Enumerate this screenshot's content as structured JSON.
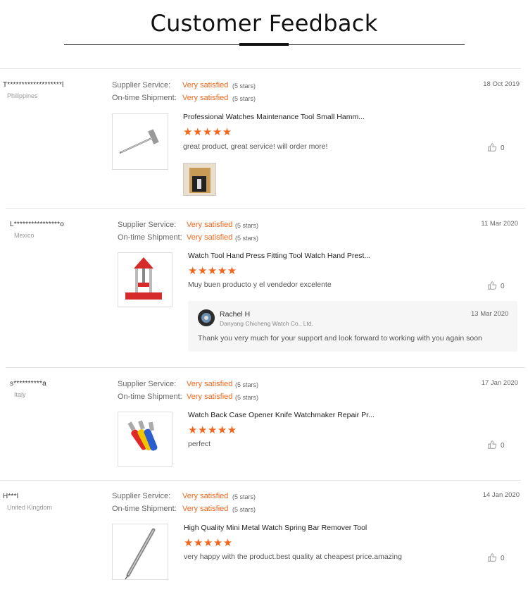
{
  "header": {
    "title": "Customer Feedback"
  },
  "labels": {
    "supplier_service": "Supplier Service:",
    "on_time_shipment": "On-time Shipment:"
  },
  "reviews": [
    {
      "buyer": "T*******************l",
      "country": "Philippines",
      "supplier_rating": "Very satisfied",
      "supplier_stars": "(5 stars)",
      "shipment_rating": "Very satisfied",
      "shipment_stars": "(5 stars)",
      "date": "18 Oct 2019",
      "product_title": "Professional Watches Maintenance Tool Small Hamm...",
      "rating_stars": "★★★★★",
      "comment": "great product, great service! will order more!",
      "likes": "0",
      "has_photo": true
    },
    {
      "buyer": "L****************o",
      "country": "Mexico",
      "supplier_rating": "Very satisfied",
      "supplier_stars": "(5 stars)",
      "shipment_rating": "Very satisfied",
      "shipment_stars": "(5 stars)",
      "date": "11 Mar 2020",
      "product_title": "Watch Tool Hand Press Fitting Tool Watch Hand Prest...",
      "rating_stars": "★★★★★",
      "comment": "Muy buen producto y el vendedor excelente",
      "likes": "0",
      "reply": {
        "name": "Rachel H",
        "company": "Danyang Chicheng Watch Co., Ltd.",
        "date": "13 Mar 2020",
        "text": "Thank you very much for your support and look forward to working with you again soon"
      }
    },
    {
      "buyer": "s**********a",
      "country": "Italy",
      "supplier_rating": "Very satisfied",
      "supplier_stars": "(5 stars)",
      "shipment_rating": "Very satisfied",
      "shipment_stars": "(5 stars)",
      "date": "17 Jan 2020",
      "product_title": "Watch Back Case Opener Knife Watchmaker Repair Pr...",
      "rating_stars": "★★★★★",
      "comment": "perfect",
      "likes": "0"
    },
    {
      "buyer": "H***l",
      "country": "United Kingdom",
      "supplier_rating": "Very satisfied",
      "supplier_stars": "(5 stars)",
      "shipment_rating": "Very satisfied",
      "shipment_stars": "(5 stars)",
      "date": "14 Jan 2020",
      "product_title": "High Quality Mini Metal Watch Spring Bar Remover Tool",
      "rating_stars": "★★★★★",
      "comment": "very happy with the product.best quality at cheapest price.amazing",
      "likes": "0"
    }
  ],
  "colors": {
    "accent": "#f2671d",
    "text": "#333333",
    "muted": "#999999"
  },
  "icons": {
    "like": "thumbs-up-icon",
    "star": "star-icon"
  }
}
